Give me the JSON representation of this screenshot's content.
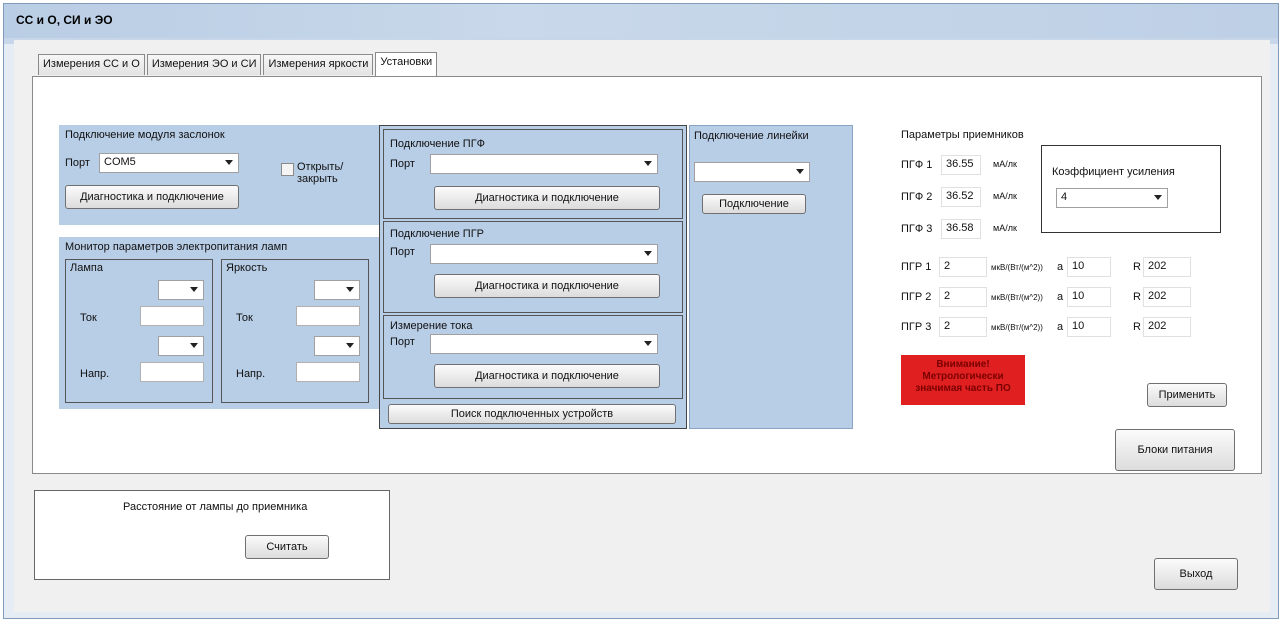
{
  "window": {
    "title": "СС и О, СИ и ЭО"
  },
  "tabs": [
    {
      "label": "Измерения СС и О"
    },
    {
      "label": "Измерения ЭО и СИ"
    },
    {
      "label": "Измерения яркости"
    },
    {
      "label": "Установки"
    }
  ],
  "shutter_module": {
    "title": "Подключение модуля заслонок",
    "port_label": "Порт",
    "port_value": "COM5",
    "open_close_label": "Открыть/ закрыть",
    "diag_button": "Диагностика и подключение"
  },
  "power_monitor": {
    "title": "Монитор параметров электропитания ламп",
    "lamp": {
      "title": "Лампа",
      "current_label": "Ток",
      "voltage_label": "Напр."
    },
    "brightness": {
      "title": "Яркость",
      "current_label": "Ток",
      "voltage_label": "Напр."
    }
  },
  "pgf": {
    "title": "Подключение ПГФ",
    "port_label": "Порт",
    "diag_button": "Диагностика и подключение"
  },
  "pgr": {
    "title": "Подключение ПГР",
    "port_label": "Порт",
    "diag_button": "Диагностика и подключение"
  },
  "current_meas": {
    "title": "Измерение тока",
    "port_label": "Порт",
    "diag_button": "Диагностика и подключение"
  },
  "search_button": "Поиск подключенных устройств",
  "ruler": {
    "title": "Подключение линейки",
    "connect_button": "Подключение"
  },
  "receivers": {
    "title": "Параметры приемников",
    "pgf_rows": [
      {
        "label": "ПГФ 1",
        "value": "36.55",
        "unit": "мА/лк"
      },
      {
        "label": "ПГФ 2",
        "value": "36.52",
        "unit": "мА/лк"
      },
      {
        "label": "ПГФ 3",
        "value": "36.58",
        "unit": "мА/лк"
      }
    ],
    "gain": {
      "title": "Коэффициент усиления",
      "value": "4"
    },
    "pgr_rows": [
      {
        "label": "ПГР 1",
        "value": "2",
        "unit": "мкВ/(Вт/(м^2))",
        "a_label": "a",
        "a_value": "10",
        "r_label": "R",
        "r_value": "202"
      },
      {
        "label": "ПГР 2",
        "value": "2",
        "unit": "мкВ/(Вт/(м^2))",
        "a_label": "a",
        "a_value": "10",
        "r_label": "R",
        "r_value": "202"
      },
      {
        "label": "ПГР 3",
        "value": "2",
        "unit": "мкВ/(Вт/(м^2))",
        "a_label": "a",
        "a_value": "10",
        "r_label": "R",
        "r_value": "202"
      }
    ],
    "warning": "Внимание! Метрологически значимая часть ПО",
    "apply_button": "Применить"
  },
  "power_supplies_button": "Блоки питания",
  "distance": {
    "title": "Расстояние от лампы до приемника",
    "read_button": "Считать"
  },
  "exit_button": "Выход",
  "colors": {
    "panel_blue": "#b8cde6",
    "warning_red": "#e02020"
  }
}
